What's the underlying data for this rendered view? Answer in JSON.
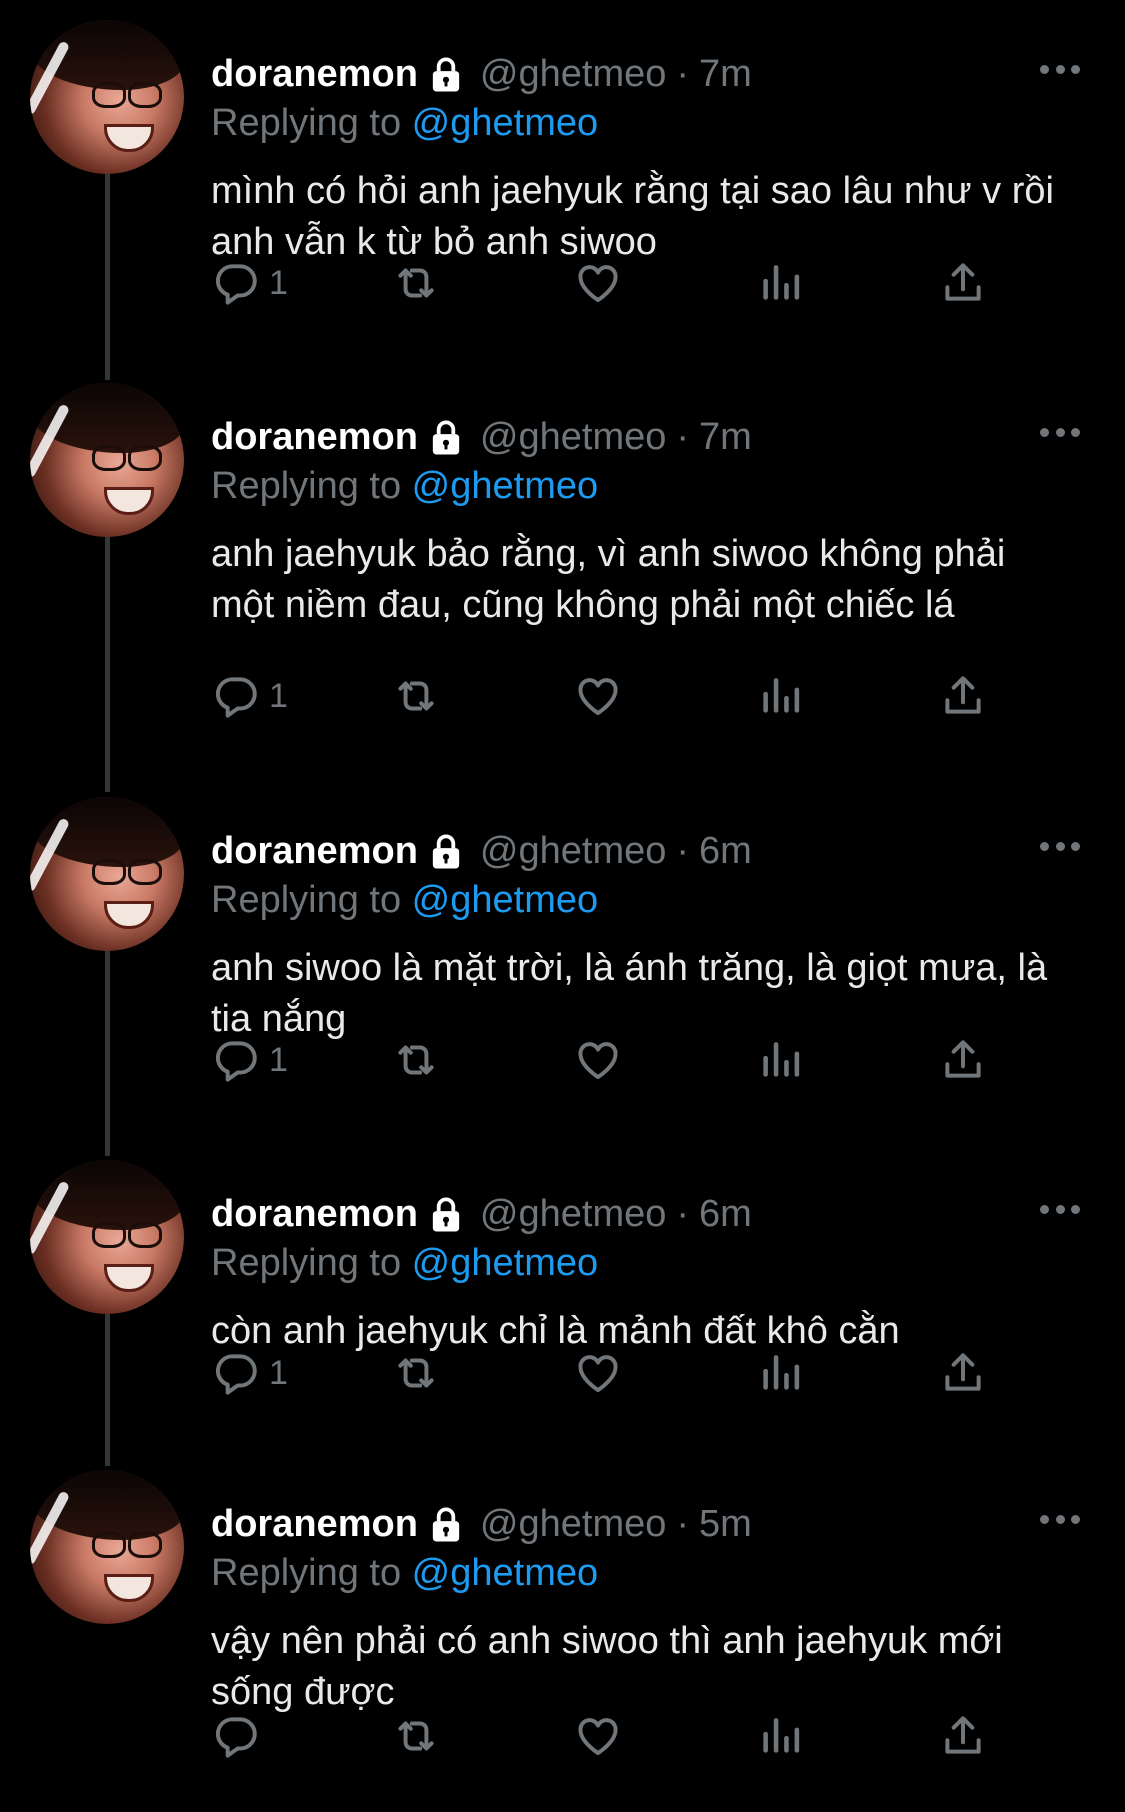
{
  "tweets": [
    {
      "display_name": "doranemon",
      "handle": "@ghetmeo",
      "separator": "·",
      "time": "7m",
      "replying_prefix": "Replying to ",
      "replying_to": "@ghetmeo",
      "text": "mình có hỏi anh jaehyuk rằng tại sao lâu như v rồi anh vẫn k từ bỏ anh siwoo",
      "reply_count": "1"
    },
    {
      "display_name": "doranemon",
      "handle": "@ghetmeo",
      "separator": "·",
      "time": "7m",
      "replying_prefix": "Replying to ",
      "replying_to": "@ghetmeo",
      "text": "anh jaehyuk bảo rằng, vì anh siwoo không phải một niềm đau, cũng không phải một chiếc lá",
      "reply_count": "1"
    },
    {
      "display_name": "doranemon",
      "handle": "@ghetmeo",
      "separator": "·",
      "time": "6m",
      "replying_prefix": "Replying to ",
      "replying_to": "@ghetmeo",
      "text": "anh siwoo là mặt trời, là ánh trăng, là giọt mưa, là tia nắng",
      "reply_count": "1"
    },
    {
      "display_name": "doranemon",
      "handle": "@ghetmeo",
      "separator": "·",
      "time": "6m",
      "replying_prefix": "Replying to ",
      "replying_to": "@ghetmeo",
      "text": "còn anh jaehyuk chỉ là mảnh đất khô cằn",
      "reply_count": "1"
    },
    {
      "display_name": "doranemon",
      "handle": "@ghetmeo",
      "separator": "·",
      "time": "5m",
      "replying_prefix": "Replying to ",
      "replying_to": "@ghetmeo",
      "text": "vậy nên phải có anh siwoo thì anh jaehyuk mới sống được",
      "reply_count": ""
    }
  ],
  "icons": {
    "lock": "lock-icon",
    "more": "more-icon",
    "reply": "reply-icon",
    "retweet": "retweet-icon",
    "like": "like-icon",
    "views": "views-icon",
    "share": "share-icon"
  },
  "colors": {
    "background": "#000000",
    "primary_text": "#e7e9ea",
    "secondary_text": "#71767b",
    "link": "#1d9bf0",
    "thread_line": "#333639"
  }
}
